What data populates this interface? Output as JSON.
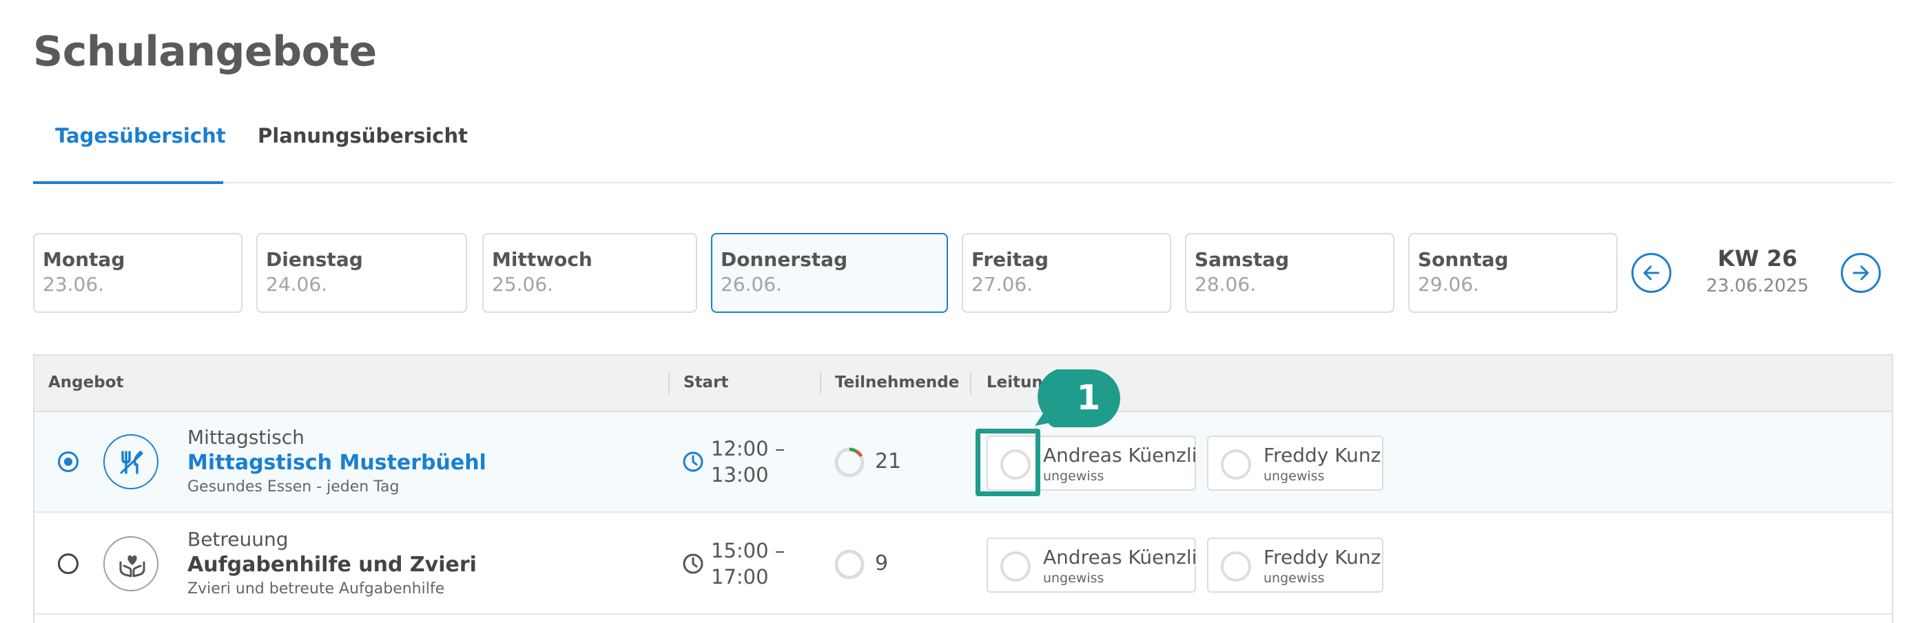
{
  "page": {
    "title": "Schulangebote"
  },
  "tabs": [
    {
      "label": "Tagesübersicht",
      "active": true
    },
    {
      "label": "Planungsübersicht",
      "active": false
    }
  ],
  "days": [
    {
      "name": "Montag",
      "date": "23.06."
    },
    {
      "name": "Dienstag",
      "date": "24.06."
    },
    {
      "name": "Mittwoch",
      "date": "25.06."
    },
    {
      "name": "Donnerstag",
      "date": "26.06.",
      "selected": true
    },
    {
      "name": "Freitag",
      "date": "27.06."
    },
    {
      "name": "Samstag",
      "date": "28.06."
    },
    {
      "name": "Sonntag",
      "date": "29.06."
    }
  ],
  "week": {
    "label": "KW 26",
    "date": "23.06.2025",
    "prev_icon": "arrow-left-icon",
    "next_icon": "arrow-right-icon"
  },
  "table": {
    "columns": [
      "Angebot",
      "Start",
      "Teilnehmende",
      "Leitung"
    ],
    "rows": [
      {
        "selected": true,
        "category": "Mittagstisch",
        "category_icon": "cutlery-icon",
        "title": "Mittagstisch Musterbüehl",
        "description": "Gesundes Essen - jeden Tag",
        "time_start": "12:00 –",
        "time_end": "13:00",
        "participants": "21",
        "leaders": [
          {
            "name": "Andreas Küenzli",
            "status": "ungewiss"
          },
          {
            "name": "Freddy Kunz",
            "status": "ungewiss"
          }
        ]
      },
      {
        "selected": false,
        "category": "Betreuung",
        "category_icon": "caring-hands-icon",
        "title": "Aufgabenhilfe und Zvieri",
        "description": "Zvieri und betreute Aufgabenhilfe",
        "time_start": "15:00 –",
        "time_end": "17:00",
        "participants": "9",
        "leaders": [
          {
            "name": "Andreas Küenzli",
            "status": "ungewiss"
          },
          {
            "name": "Freddy Kunz",
            "status": "ungewiss"
          }
        ]
      }
    ]
  },
  "annotation": {
    "number": "1"
  },
  "colors": {
    "accent": "#1a7fd0",
    "annotation": "#1f9c8c",
    "progress_green": "#3aa15a",
    "progress_red": "#e0523a"
  }
}
